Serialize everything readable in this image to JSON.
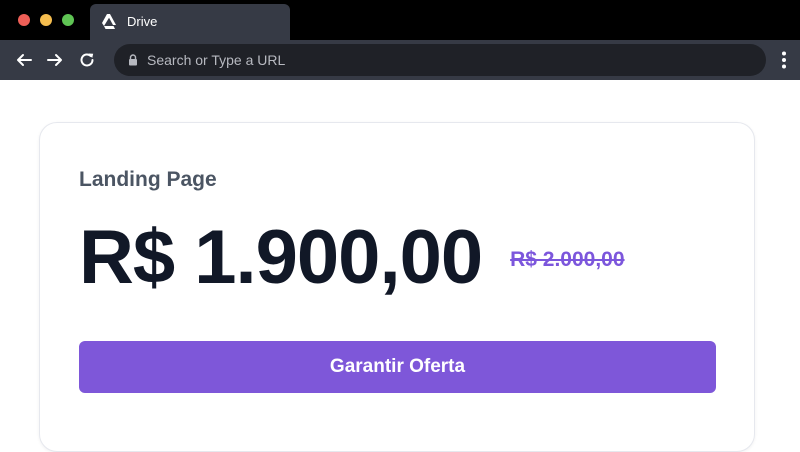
{
  "browser": {
    "tab_title": "Drive",
    "address_placeholder": "Search or Type a URL"
  },
  "card": {
    "title": "Landing Page",
    "price": "R$ 1.900,00",
    "original_price": "R$ 2.000,00",
    "cta_label": "Garantir Oferta"
  },
  "colors": {
    "accent": "#7e57d9",
    "strike_price": "#7c56dc",
    "price_text": "#111827",
    "chrome_dark": "#363a45"
  }
}
